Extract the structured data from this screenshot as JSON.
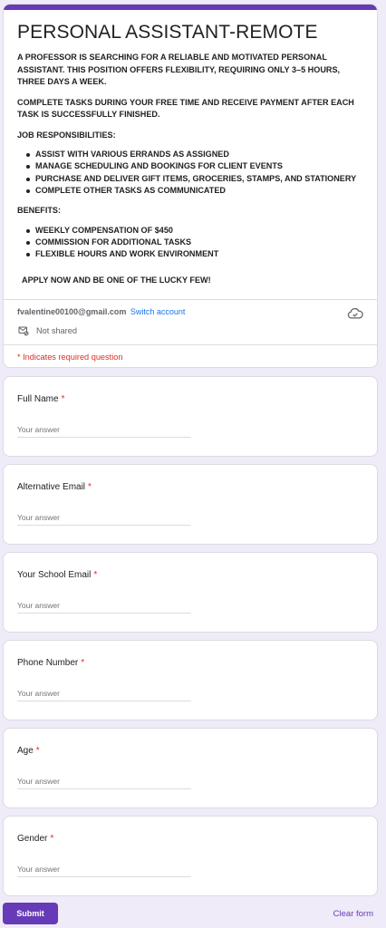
{
  "form": {
    "title": "PERSONAL ASSISTANT-REMOTE",
    "intro": "A  PROFESSOR IS SEARCHING FOR A RELIABLE AND MOTIVATED PERSONAL ASSISTANT. THIS POSITION OFFERS FLEXIBILITY, REQUIRING ONLY 3–5 HOURS, THREE DAYS A WEEK.",
    "intro2": "COMPLETE TASKS DURING YOUR FREE TIME AND RECEIVE PAYMENT AFTER EACH TASK IS SUCCESSFULLY FINISHED.",
    "responsibilities_heading": "JOB RESPONSIBILITIES:",
    "responsibilities": [
      "ASSIST WITH VARIOUS ERRANDS AS ASSIGNED",
      "MANAGE SCHEDULING AND BOOKINGS FOR CLIENT EVENTS",
      "PURCHASE AND DELIVER GIFT ITEMS, GROCERIES, STAMPS, AND STATIONERY",
      "COMPLETE OTHER TASKS AS COMMUNICATED"
    ],
    "benefits_heading": "BENEFITS:",
    "benefits": [
      "WEEKLY COMPENSATION OF $450",
      "COMMISSION FOR ADDITIONAL TASKS",
      "FLEXIBLE HOURS AND WORK ENVIRONMENT"
    ],
    "apply": "APPLY NOW AND BE ONE OF THE LUCKY FEW!"
  },
  "account": {
    "email": "fvalentine00100@gmail.com",
    "switch_label": "Switch account",
    "not_shared": "Not shared"
  },
  "required_note": "* Indicates required question",
  "questions": [
    {
      "label": "Full Name",
      "required": "*",
      "placeholder": "Your answer"
    },
    {
      "label": "Alternative Email",
      "required": "*",
      "placeholder": "Your answer"
    },
    {
      "label": "Your School Email",
      "required": "*",
      "placeholder": "Your answer"
    },
    {
      "label": "Phone Number",
      "required": "*",
      "placeholder": "Your answer"
    },
    {
      "label": "Age",
      "required": "*",
      "placeholder": "Your answer"
    },
    {
      "label": "Gender",
      "required": "*",
      "placeholder": "Your answer"
    }
  ],
  "actions": {
    "submit_label": "Submit",
    "clear_label": "Clear form"
  },
  "colors": {
    "accent": "#673ab7",
    "background": "#f0ebf8",
    "required": "#d93025",
    "link": "#1a73e8"
  },
  "icons": {
    "cloud": "cloud-saved-icon",
    "mail": "not-shared-mail-icon"
  }
}
